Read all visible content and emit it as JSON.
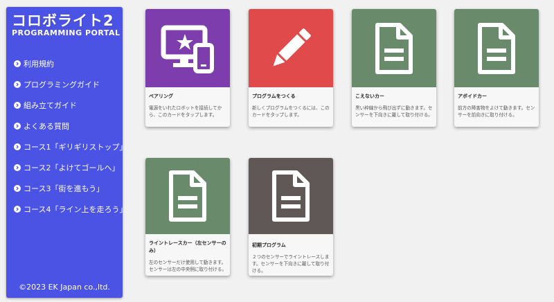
{
  "sidebar": {
    "logo_title": "コロボライト2",
    "logo_subtitle": "PROGRAMMING PORTAL",
    "items": [
      {
        "label": "利用規約"
      },
      {
        "label": "プログラミングガイド"
      },
      {
        "label": "組み立てガイド"
      },
      {
        "label": "よくある質問"
      },
      {
        "label": "コース1「ギリギリストップ」"
      },
      {
        "label": "コース2「よけてゴールへ」"
      },
      {
        "label": "コース3「街を進もう」"
      },
      {
        "label": "コース4「ライン上を走ろう」"
      }
    ],
    "footer": "©2023 EK Japan co.,ltd."
  },
  "cards": [
    {
      "title": "ペアリング",
      "description": "電源をいれたロボットを接続してから、このカードをタップします。",
      "icon": "devices-star-icon",
      "color": "#7d3dad"
    },
    {
      "title": "プログラムをつくる",
      "description": "新しくプログラムをつくるには、このカードをタップします。",
      "icon": "pencil-icon",
      "color": "#e04a4a"
    },
    {
      "title": "こえないカー",
      "description": "黒い枠線から飛び出ずに動きます。センサーを下向きに離して取り付ける。",
      "icon": "document-icon",
      "color": "#6a8a6c"
    },
    {
      "title": "アボイドカー",
      "description": "前方の障害物をよけて動きます。センサーを前向きに取り付ける。",
      "icon": "document-icon",
      "color": "#6a8a6c"
    },
    {
      "title": "ライントレースカー（左センサーのみ）",
      "description": "左のセンサーだけ使用して動きます。センサーは左の中央側に取り付ける。",
      "icon": "document-icon",
      "color": "#6a8a6c"
    },
    {
      "title": "初期プログラム",
      "description": "２つのセンサーでライントレースします。センサーを下向きに離して取り付ける。",
      "icon": "document-icon",
      "color": "#5f5856"
    }
  ]
}
